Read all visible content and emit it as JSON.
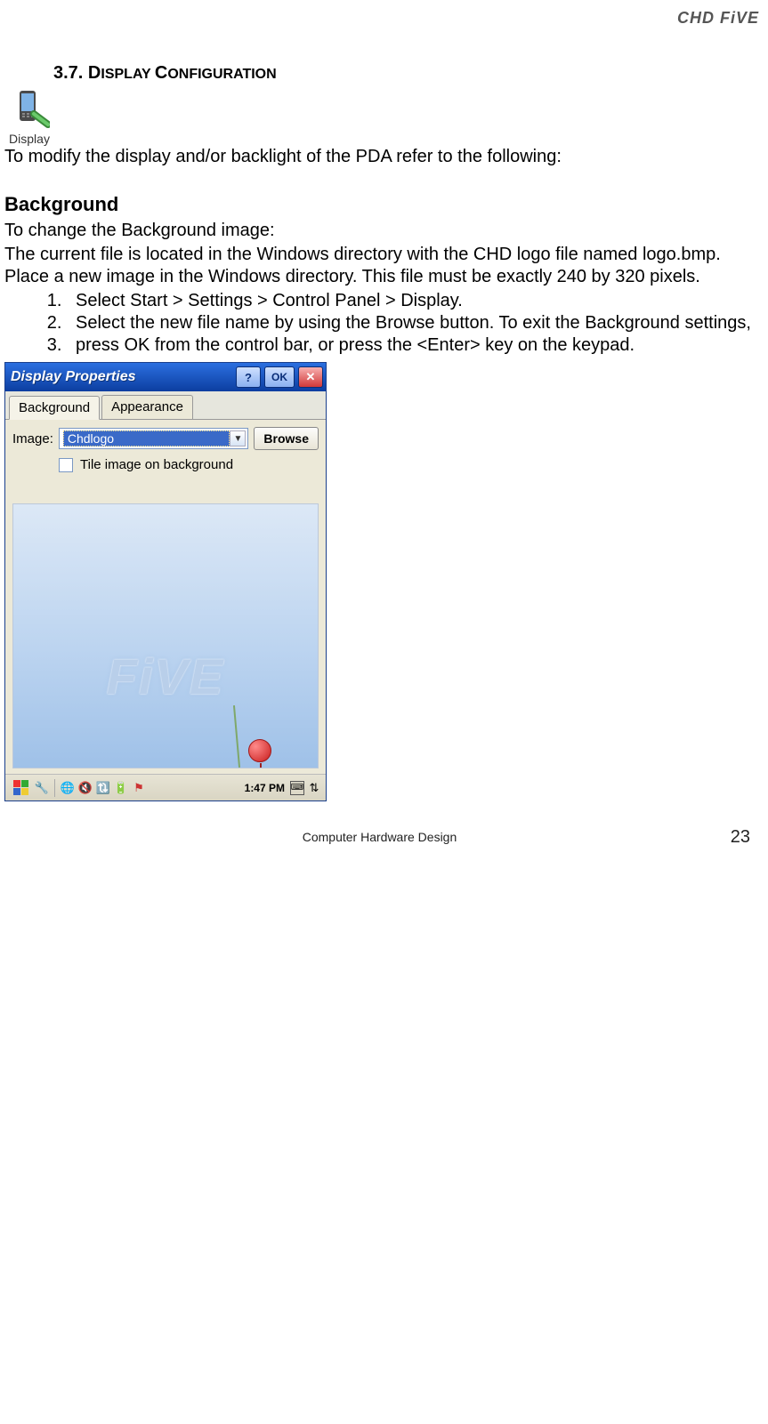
{
  "header": {
    "brand": "CHD FiVE"
  },
  "section": {
    "number": "3.7.",
    "title_prefix": "D",
    "title_rest": "ISPLAY ",
    "title_prefix2": "C",
    "title_rest2": "ONFIGURATION",
    "icon_label": "Display"
  },
  "intro_line": "To modify the display and/or backlight of the PDA refer to the following:",
  "background": {
    "heading": "Background",
    "p1": "To change the Background image:",
    "p2": "The current file is located in the Windows directory with the CHD logo file named logo.bmp. Place a new image in the Windows directory. This file must be exactly 240 by 320 pixels.",
    "steps": [
      "Select Start > Settings > Control Panel > Display.",
      "Select the new file name by using the Browse button. To exit the Background settings,",
      "press OK from the control bar, or press the <Enter> key on the keypad."
    ]
  },
  "screenshot": {
    "title": "Display Properties",
    "help": "?",
    "ok": "OK",
    "close": "✕",
    "tabs": {
      "bg": "Background",
      "appearance": "Appearance"
    },
    "image_label": "Image:",
    "image_value": "Chdlogo",
    "browse": "Browse",
    "tile_label": "Tile image on background",
    "logo": "FiVE",
    "clock": "1:47 PM"
  },
  "footer": {
    "text": "Computer Hardware Design",
    "page": "23"
  }
}
